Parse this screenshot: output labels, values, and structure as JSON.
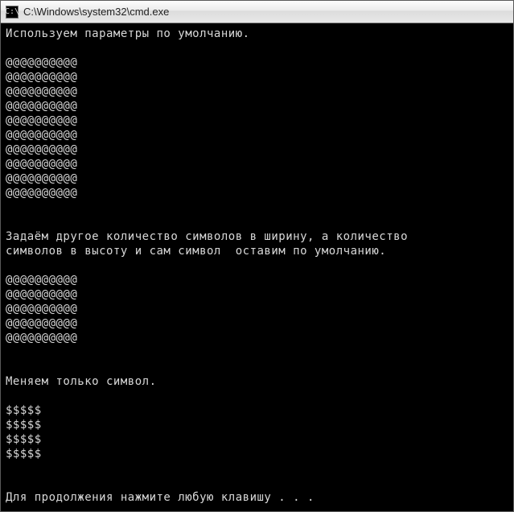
{
  "window": {
    "icon_glyph": "C:\\",
    "title": "C:\\Windows\\system32\\cmd.exe"
  },
  "console": {
    "lines": [
      "Используем параметры по умолчанию.",
      "",
      "@@@@@@@@@@",
      "@@@@@@@@@@",
      "@@@@@@@@@@",
      "@@@@@@@@@@",
      "@@@@@@@@@@",
      "@@@@@@@@@@",
      "@@@@@@@@@@",
      "@@@@@@@@@@",
      "@@@@@@@@@@",
      "@@@@@@@@@@",
      "",
      "",
      "Задаём другое количество символов в ширину, а количество",
      "символов в высоту и сам символ  оставим по умолчанию.",
      "",
      "@@@@@@@@@@",
      "@@@@@@@@@@",
      "@@@@@@@@@@",
      "@@@@@@@@@@",
      "@@@@@@@@@@",
      "",
      "",
      "Меняем только символ.",
      "",
      "$$$$$",
      "$$$$$",
      "$$$$$",
      "$$$$$",
      "",
      "",
      "Для продолжения нажмите любую клавишу . . ."
    ]
  }
}
